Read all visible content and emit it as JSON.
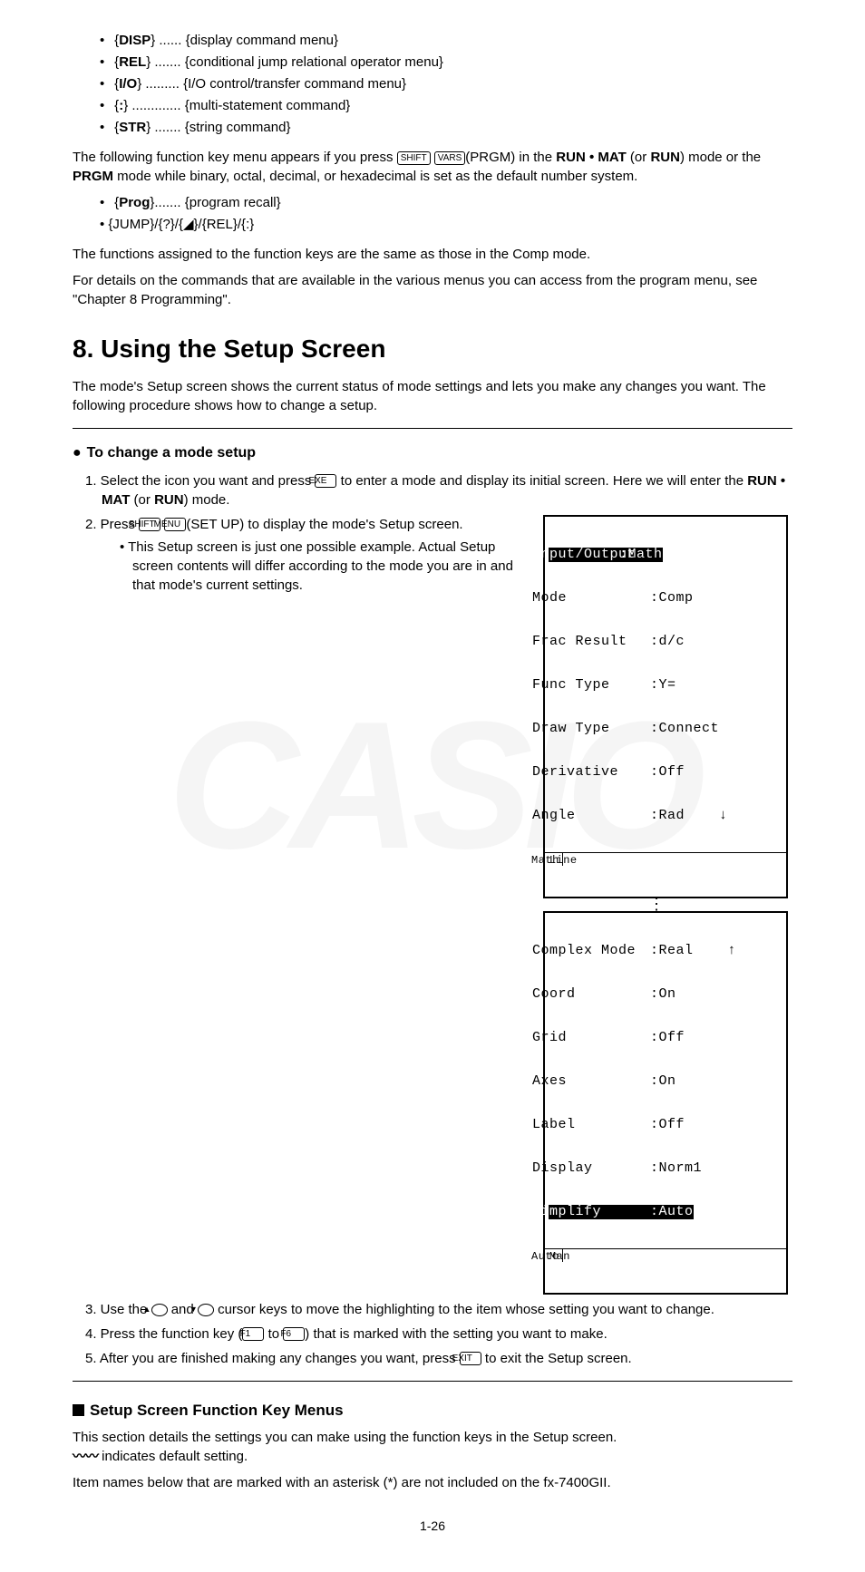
{
  "menu_items": [
    {
      "name": "DISP",
      "dots": "......",
      "desc": "{display command menu}"
    },
    {
      "name": "REL",
      "dots": ".......",
      "desc": "{conditional jump relational operator menu}"
    },
    {
      "name": "I/O",
      "dots": ".........",
      "desc": "{I/O control/transfer command menu}"
    },
    {
      "name": ":",
      "dots": ".............",
      "desc": "{multi-statement command}"
    },
    {
      "name": "STR",
      "dots": ".......",
      "desc": "{string command}"
    }
  ],
  "para1_pre": "The following function key menu appears if you press ",
  "para1_key1": "SHIFT",
  "para1_key2": "VARS",
  "para1_mid": "(PRGM) in the ",
  "para1_bold1": "RUN • MAT",
  "para1_mid2": " (or ",
  "para1_bold2": "RUN",
  "para1_mid3": ") mode or the ",
  "para1_bold3": "PRGM",
  "para1_end": " mode while binary, octal, decimal, or hexadecimal is set as the default number system.",
  "prog_item_name": "Prog",
  "prog_item_dots": ".......",
  "prog_item_desc": "{program recall}",
  "jump_line": "• {JUMP}/{?}/{◢}/{REL}/{:}",
  "para2": "The functions assigned to the function keys are the same as those in the Comp mode.",
  "para3": "For details on the commands that are available in the various menus you can access from the program menu, see \"Chapter 8 Programming\".",
  "section8": "8. Using the Setup Screen",
  "para4": "The mode's Setup screen shows the current status of mode settings and lets you make any changes you want. The following procedure shows how to change a setup.",
  "sub1": "To change a mode setup",
  "step1_pre": "1. Select the icon you want and press ",
  "step1_key": "EXE",
  "step1_mid": " to enter a mode and display its initial screen. Here we will enter the ",
  "step1_bold": "RUN • MAT",
  "step1_mid2": " (or ",
  "step1_bold2": "RUN",
  "step1_end": ") mode.",
  "step2_pre": "2. Press ",
  "step2_k1": "SHIFT",
  "step2_k2": "MENU",
  "step2_end": "(SET UP) to display the mode's Setup screen.",
  "step2_note": "• This Setup screen is just one possible example. Actual Setup screen contents will differ according to the mode you are in and that mode's current settings.",
  "lcd1": {
    "rows": [
      {
        "l": "Input/Output",
        "r": ":Math",
        "hl_l": true,
        "hl_r": true
      },
      {
        "l": "Mode",
        "r": ":Comp"
      },
      {
        "l": "Frac Result",
        "r": ":d/c"
      },
      {
        "l": "Func Type",
        "r": ":Y="
      },
      {
        "l": "Draw Type",
        "r": ":Connect"
      },
      {
        "l": "Derivative",
        "r": ":Off"
      },
      {
        "l": "Angle",
        "r": ":Rad    ↓"
      }
    ],
    "soft": [
      "Math",
      "Line"
    ]
  },
  "lcd2": {
    "rows": [
      {
        "l": "Complex Mode",
        "r": ":Real    ↑"
      },
      {
        "l": "Coord",
        "r": ":On"
      },
      {
        "l": "Grid",
        "r": ":Off"
      },
      {
        "l": "Axes",
        "r": ":On"
      },
      {
        "l": "Label",
        "r": ":Off"
      },
      {
        "l": "Display",
        "r": ":Norm1"
      },
      {
        "l": "Simplify",
        "r": ":Auto",
        "hl_l": true,
        "hl_r": true
      }
    ],
    "soft": [
      "Auto",
      "Man"
    ]
  },
  "step3_pre": "3. Use the ",
  "step3_mid": " and ",
  "step3_end": " cursor keys to move the highlighting to the item whose setting you want to change.",
  "step4_pre": "4. Press the function key (",
  "step4_k1": "F1",
  "step4_mid": " to ",
  "step4_k2": "F6",
  "step4_end": ") that is marked with the setting you want to make.",
  "step5_pre": "5. After you are finished making any changes you want, press ",
  "step5_key": "EXIT",
  "step5_end": " to exit the Setup screen.",
  "sub2": "Setup Screen Function Key Menus",
  "para5_pre": "This section details the settings you can make using the function keys in the Setup screen.",
  "para5_end": " indicates default setting.",
  "para6": "Item names below that are marked with an asterisk (*) are not included on the fx-7400GII.",
  "pagenum": "1-26"
}
